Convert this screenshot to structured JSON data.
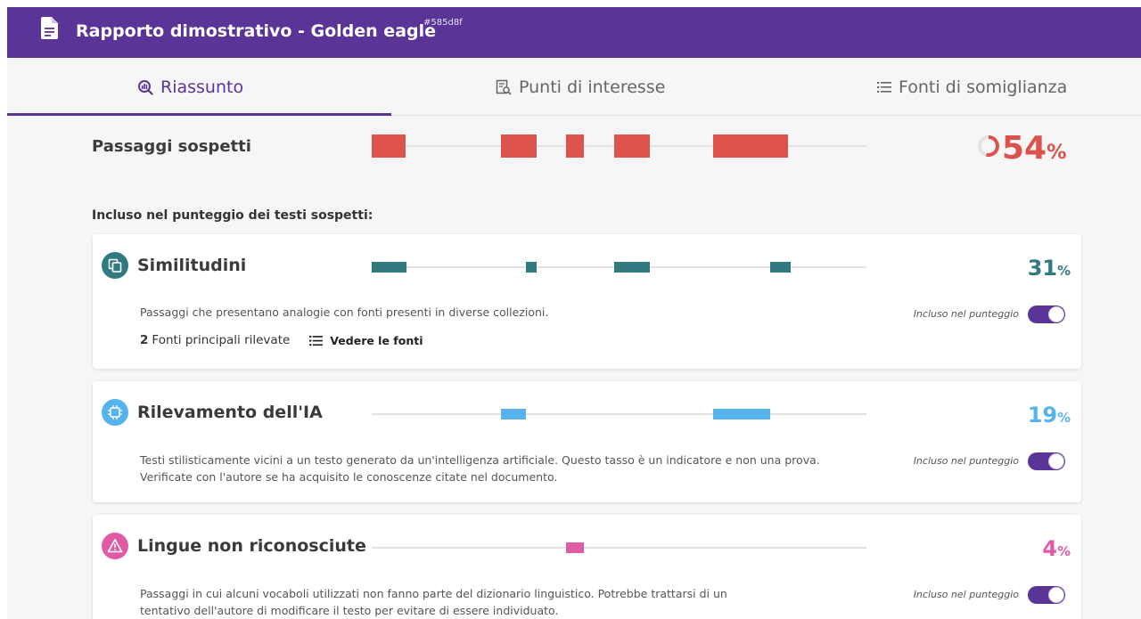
{
  "header": {
    "title": "Rapporto dimostrativo - Golden eagle",
    "id_badge": "#585d8f",
    "icon": "document-icon"
  },
  "tabs": [
    {
      "label": "Riassunto",
      "icon": "analysis-icon",
      "active": true
    },
    {
      "label": "Punti di interesse",
      "icon": "doc-search-icon",
      "active": false
    },
    {
      "label": "Fonti di somiglianza",
      "icon": "list-icon",
      "active": false
    }
  ],
  "suspicious": {
    "label": "Passaggi sospetti",
    "percent": "54",
    "percent_sign": "%",
    "value": 0.54,
    "color": "#dc524c",
    "segments": [
      [
        0.0,
        0.068
      ],
      [
        0.261,
        0.333
      ],
      [
        0.392,
        0.428
      ],
      [
        0.49,
        0.562
      ],
      [
        0.69,
        0.842
      ]
    ]
  },
  "included_heading": "Incluso nel punteggio dei testi sospetti:",
  "cards": [
    {
      "title": "Similitudini",
      "icon": "copy-icon",
      "color": "#317a7f",
      "percent": "31",
      "percent_sign": "%",
      "value": 0.31,
      "description": "Passaggi che presentano analogie con fonti presenti in diverse collezioni.",
      "included_label": "Incluso nel punteggio",
      "toggle_on": true,
      "sources_count": "2",
      "sources_label": "Fonti principali rilevate",
      "see_sources": "Vedere le fonti",
      "segments": [
        [
          0.0,
          0.07
        ],
        [
          0.311,
          0.333
        ],
        [
          0.49,
          0.562
        ],
        [
          0.806,
          0.846
        ]
      ]
    },
    {
      "title": "Rilevamento dell'IA",
      "icon": "ai-chip-icon",
      "color": "#56b3eb",
      "percent": "19",
      "percent_sign": "%",
      "value": 0.19,
      "description_line1": "Testi stilisticamente vicini a un testo generato da un'intelligenza artificiale. Questo tasso è un indicatore e non una prova.",
      "description_line2": "Verificate con l'autore se ha acquisito le conoscenze citate nel documento.",
      "included_label": "Incluso nel punteggio",
      "toggle_on": true,
      "segments": [
        [
          0.261,
          0.311
        ],
        [
          0.69,
          0.806
        ]
      ]
    },
    {
      "title": "Lingue non riconosciute",
      "icon": "warning-language-icon",
      "color": "#e05aa6",
      "percent": "4",
      "percent_sign": "%",
      "value": 0.04,
      "description_line1": "Passaggi in cui alcuni vocaboli utilizzati non fanno parte del dizionario linguistico. Potrebbe trattarsi di un",
      "description_line2": "tentativo dell'autore di modificare il testo per evitare di essere individuato.",
      "included_label": "Incluso nel punteggio",
      "toggle_on": true,
      "segments": [
        [
          0.392,
          0.428
        ]
      ]
    }
  ]
}
